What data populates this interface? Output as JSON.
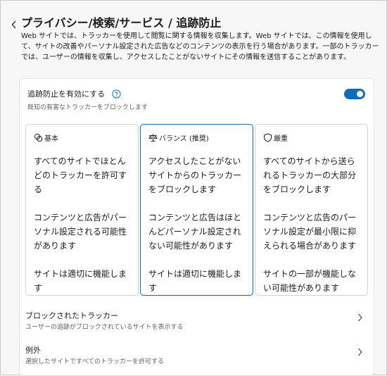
{
  "header": {
    "title": "プライバシー/検索/サービス / 追跡防止",
    "description": "Web サイトでは、トラッカーを使用して閲覧に関する情報を収集します。Web サイトでは、この情報を使用して、サイトの改善やパーソナル設定された広告などのコンテンツの表示を行う場合があります。一部のトラッカーでは、ユーザーの情報を収集し、アクセスしたことがないサイトにその情報を送信することがあります。"
  },
  "toggle": {
    "label": "追跡防止を有効にする",
    "sublabel": "既知の有害なトラッカーをブロックします",
    "enabled": true
  },
  "levels": [
    {
      "name": "基本",
      "icon": "circles-icon",
      "selected": false,
      "lines": [
        "すべてのサイトでほとんどのトラッカーを許可する",
        "コンテンツと広告がパーソナル設定される可能性があります",
        "サイトは適切に機能します"
      ]
    },
    {
      "name": "バランス (推奨)",
      "icon": "scales-icon",
      "selected": true,
      "lines": [
        "アクセスしたことがないサイトからのトラッカーをブロックします",
        "コンテンツと広告はほとんどパーソナル設定されない可能性があります",
        "サイトは適切に機能します"
      ]
    },
    {
      "name": "厳重",
      "icon": "shield-icon",
      "selected": false,
      "lines": [
        "すべてのサイトから送られるトラッカーの大部分をブロックします",
        "コンテンツと広告のパーソナル設定が最小限に抑えられる場合があります",
        "サイトの一部が機能しない可能性があります"
      ]
    }
  ],
  "blocked": {
    "title": "ブロックされたトラッカー",
    "sub": "ユーザーの追跡がブロックされているサイトを表示する"
  },
  "exceptions": {
    "title": "例外",
    "sub": "選択したサイトですべてのトラッカーを許可する"
  },
  "colors": {
    "accent": "#0f6cbd",
    "text": "#1b1b1b",
    "muted": "#616161"
  }
}
